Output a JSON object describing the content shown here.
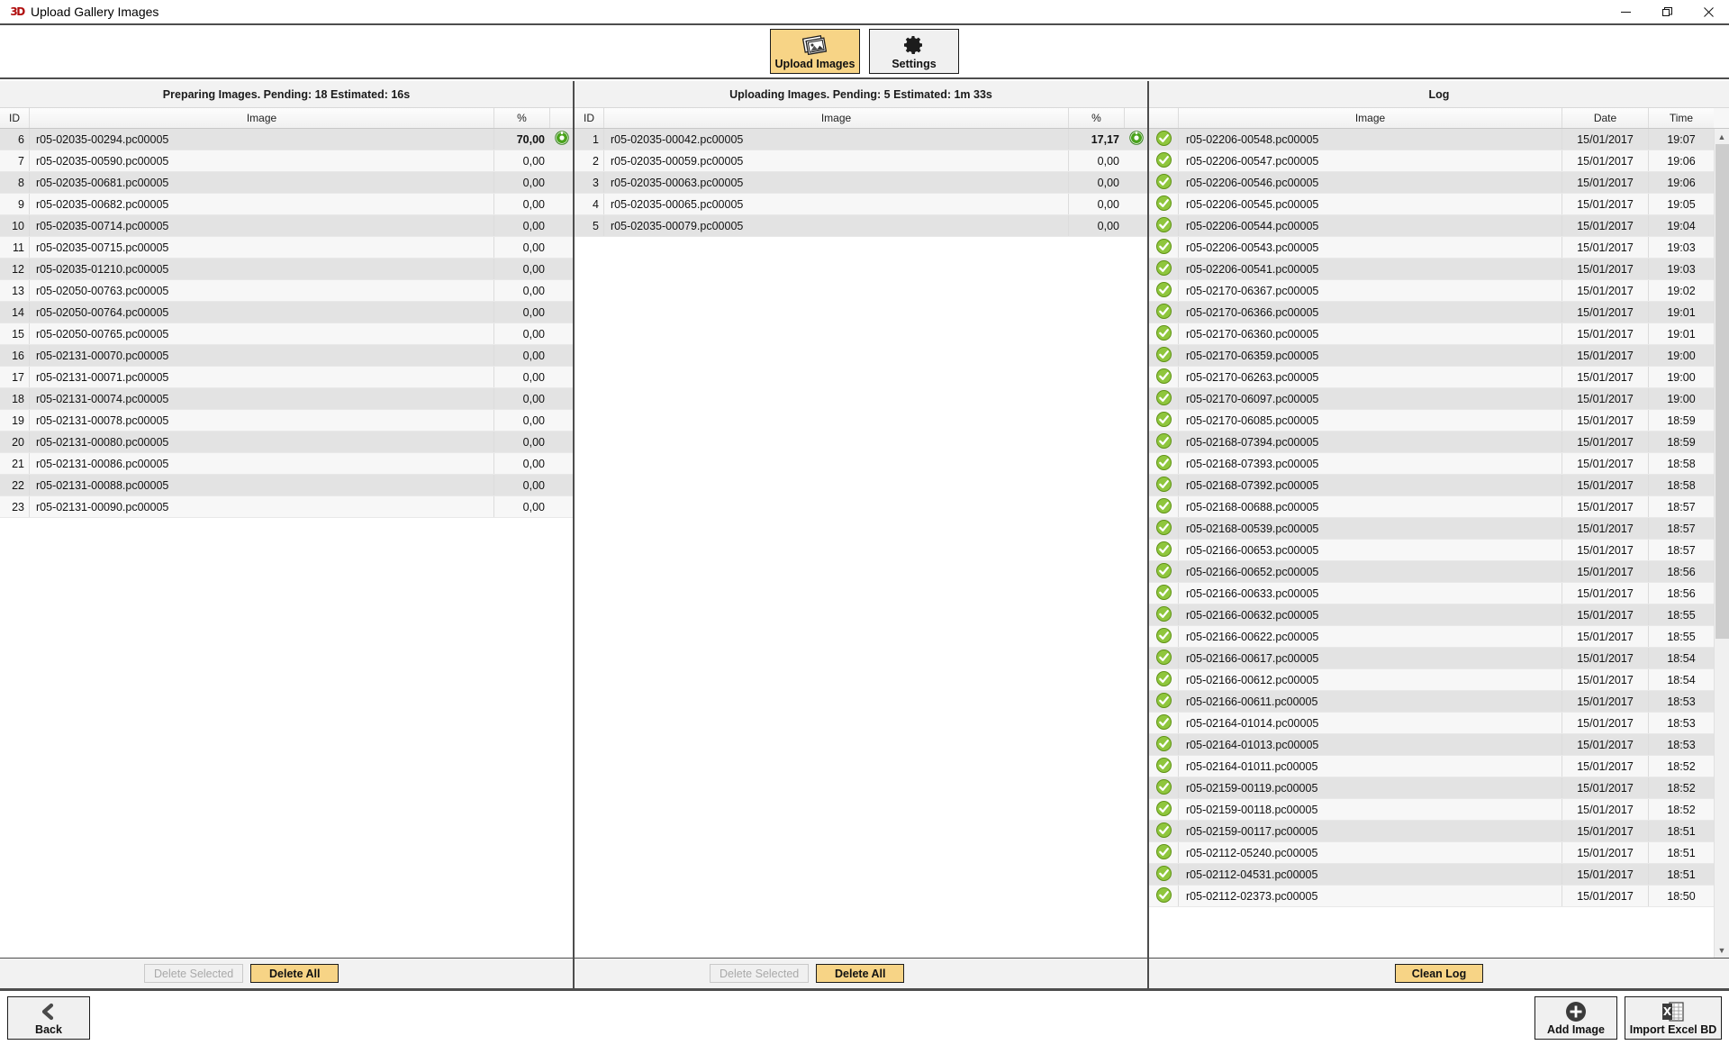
{
  "window": {
    "title": "Upload Gallery Images",
    "logo_text": "3D",
    "controls": {
      "minimize": "minimize-icon",
      "restore": "restore-icon",
      "close": "close-icon"
    }
  },
  "toolbar": {
    "buttons": [
      {
        "label": "Upload Images",
        "icon": "photo-stack-icon",
        "active": true
      },
      {
        "label": "Settings",
        "icon": "gear-icon",
        "active": false
      }
    ]
  },
  "preparing_panel": {
    "header": "Preparing Images. Pending: 18 Estimated: 16s",
    "columns": {
      "id": "ID",
      "image": "Image",
      "percent": "%"
    },
    "rows": [
      {
        "id": "6",
        "image": "r05-02035-00294.pc00005",
        "percent": "70,00",
        "active": true
      },
      {
        "id": "7",
        "image": "r05-02035-00590.pc00005",
        "percent": "0,00",
        "active": false
      },
      {
        "id": "8",
        "image": "r05-02035-00681.pc00005",
        "percent": "0,00",
        "active": false
      },
      {
        "id": "9",
        "image": "r05-02035-00682.pc00005",
        "percent": "0,00",
        "active": false
      },
      {
        "id": "10",
        "image": "r05-02035-00714.pc00005",
        "percent": "0,00",
        "active": false
      },
      {
        "id": "11",
        "image": "r05-02035-00715.pc00005",
        "percent": "0,00",
        "active": false
      },
      {
        "id": "12",
        "image": "r05-02035-01210.pc00005",
        "percent": "0,00",
        "active": false
      },
      {
        "id": "13",
        "image": "r05-02050-00763.pc00005",
        "percent": "0,00",
        "active": false
      },
      {
        "id": "14",
        "image": "r05-02050-00764.pc00005",
        "percent": "0,00",
        "active": false
      },
      {
        "id": "15",
        "image": "r05-02050-00765.pc00005",
        "percent": "0,00",
        "active": false
      },
      {
        "id": "16",
        "image": "r05-02131-00070.pc00005",
        "percent": "0,00",
        "active": false
      },
      {
        "id": "17",
        "image": "r05-02131-00071.pc00005",
        "percent": "0,00",
        "active": false
      },
      {
        "id": "18",
        "image": "r05-02131-00074.pc00005",
        "percent": "0,00",
        "active": false
      },
      {
        "id": "19",
        "image": "r05-02131-00078.pc00005",
        "percent": "0,00",
        "active": false
      },
      {
        "id": "20",
        "image": "r05-02131-00080.pc00005",
        "percent": "0,00",
        "active": false
      },
      {
        "id": "21",
        "image": "r05-02131-00086.pc00005",
        "percent": "0,00",
        "active": false
      },
      {
        "id": "22",
        "image": "r05-02131-00088.pc00005",
        "percent": "0,00",
        "active": false
      },
      {
        "id": "23",
        "image": "r05-02131-00090.pc00005",
        "percent": "0,00",
        "active": false
      }
    ],
    "delete_selected_label": "Delete Selected",
    "delete_all_label": "Delete All"
  },
  "uploading_panel": {
    "header": "Uploading Images. Pending: 5 Estimated: 1m 33s",
    "columns": {
      "id": "ID",
      "image": "Image",
      "percent": "%"
    },
    "rows": [
      {
        "id": "1",
        "image": "r05-02035-00042.pc00005",
        "percent": "17,17",
        "active": true
      },
      {
        "id": "2",
        "image": "r05-02035-00059.pc00005",
        "percent": "0,00",
        "active": false
      },
      {
        "id": "3",
        "image": "r05-02035-00063.pc00005",
        "percent": "0,00",
        "active": false
      },
      {
        "id": "4",
        "image": "r05-02035-00065.pc00005",
        "percent": "0,00",
        "active": false
      },
      {
        "id": "5",
        "image": "r05-02035-00079.pc00005",
        "percent": "0,00",
        "active": false
      }
    ],
    "delete_selected_label": "Delete Selected",
    "delete_all_label": "Delete All"
  },
  "log_panel": {
    "header": "Log",
    "columns": {
      "image": "Image",
      "date": "Date",
      "time": "Time"
    },
    "rows": [
      {
        "image": "r05-02206-00548.pc00005",
        "date": "15/01/2017",
        "time": "19:07"
      },
      {
        "image": "r05-02206-00547.pc00005",
        "date": "15/01/2017",
        "time": "19:06"
      },
      {
        "image": "r05-02206-00546.pc00005",
        "date": "15/01/2017",
        "time": "19:06"
      },
      {
        "image": "r05-02206-00545.pc00005",
        "date": "15/01/2017",
        "time": "19:05"
      },
      {
        "image": "r05-02206-00544.pc00005",
        "date": "15/01/2017",
        "time": "19:04"
      },
      {
        "image": "r05-02206-00543.pc00005",
        "date": "15/01/2017",
        "time": "19:03"
      },
      {
        "image": "r05-02206-00541.pc00005",
        "date": "15/01/2017",
        "time": "19:03"
      },
      {
        "image": "r05-02170-06367.pc00005",
        "date": "15/01/2017",
        "time": "19:02"
      },
      {
        "image": "r05-02170-06366.pc00005",
        "date": "15/01/2017",
        "time": "19:01"
      },
      {
        "image": "r05-02170-06360.pc00005",
        "date": "15/01/2017",
        "time": "19:01"
      },
      {
        "image": "r05-02170-06359.pc00005",
        "date": "15/01/2017",
        "time": "19:00"
      },
      {
        "image": "r05-02170-06263.pc00005",
        "date": "15/01/2017",
        "time": "19:00"
      },
      {
        "image": "r05-02170-06097.pc00005",
        "date": "15/01/2017",
        "time": "19:00"
      },
      {
        "image": "r05-02170-06085.pc00005",
        "date": "15/01/2017",
        "time": "18:59"
      },
      {
        "image": "r05-02168-07394.pc00005",
        "date": "15/01/2017",
        "time": "18:59"
      },
      {
        "image": "r05-02168-07393.pc00005",
        "date": "15/01/2017",
        "time": "18:58"
      },
      {
        "image": "r05-02168-07392.pc00005",
        "date": "15/01/2017",
        "time": "18:58"
      },
      {
        "image": "r05-02168-00688.pc00005",
        "date": "15/01/2017",
        "time": "18:57"
      },
      {
        "image": "r05-02168-00539.pc00005",
        "date": "15/01/2017",
        "time": "18:57"
      },
      {
        "image": "r05-02166-00653.pc00005",
        "date": "15/01/2017",
        "time": "18:57"
      },
      {
        "image": "r05-02166-00652.pc00005",
        "date": "15/01/2017",
        "time": "18:56"
      },
      {
        "image": "r05-02166-00633.pc00005",
        "date": "15/01/2017",
        "time": "18:56"
      },
      {
        "image": "r05-02166-00632.pc00005",
        "date": "15/01/2017",
        "time": "18:55"
      },
      {
        "image": "r05-02166-00622.pc00005",
        "date": "15/01/2017",
        "time": "18:55"
      },
      {
        "image": "r05-02166-00617.pc00005",
        "date": "15/01/2017",
        "time": "18:54"
      },
      {
        "image": "r05-02166-00612.pc00005",
        "date": "15/01/2017",
        "time": "18:54"
      },
      {
        "image": "r05-02166-00611.pc00005",
        "date": "15/01/2017",
        "time": "18:53"
      },
      {
        "image": "r05-02164-01014.pc00005",
        "date": "15/01/2017",
        "time": "18:53"
      },
      {
        "image": "r05-02164-01013.pc00005",
        "date": "15/01/2017",
        "time": "18:53"
      },
      {
        "image": "r05-02164-01011.pc00005",
        "date": "15/01/2017",
        "time": "18:52"
      },
      {
        "image": "r05-02159-00119.pc00005",
        "date": "15/01/2017",
        "time": "18:52"
      },
      {
        "image": "r05-02159-00118.pc00005",
        "date": "15/01/2017",
        "time": "18:52"
      },
      {
        "image": "r05-02159-00117.pc00005",
        "date": "15/01/2017",
        "time": "18:51"
      },
      {
        "image": "r05-02112-05240.pc00005",
        "date": "15/01/2017",
        "time": "18:51"
      },
      {
        "image": "r05-02112-04531.pc00005",
        "date": "15/01/2017",
        "time": "18:51"
      },
      {
        "image": "r05-02112-02373.pc00005",
        "date": "15/01/2017",
        "time": "18:50"
      }
    ],
    "clean_log_label": "Clean Log"
  },
  "bottom_bar": {
    "back_label": "Back",
    "back_icon": "chevron-left-icon",
    "add_image_label": "Add Image",
    "add_image_icon": "circle-plus-icon",
    "import_excel_label": "Import Excel BD",
    "import_excel_icon": "excel-file-icon"
  },
  "colors": {
    "accent_amber": "#f7d486",
    "status_green": "#4fa81d",
    "chrome_dark": "#4d4d4d",
    "row_alt": "#e3e3e3"
  }
}
